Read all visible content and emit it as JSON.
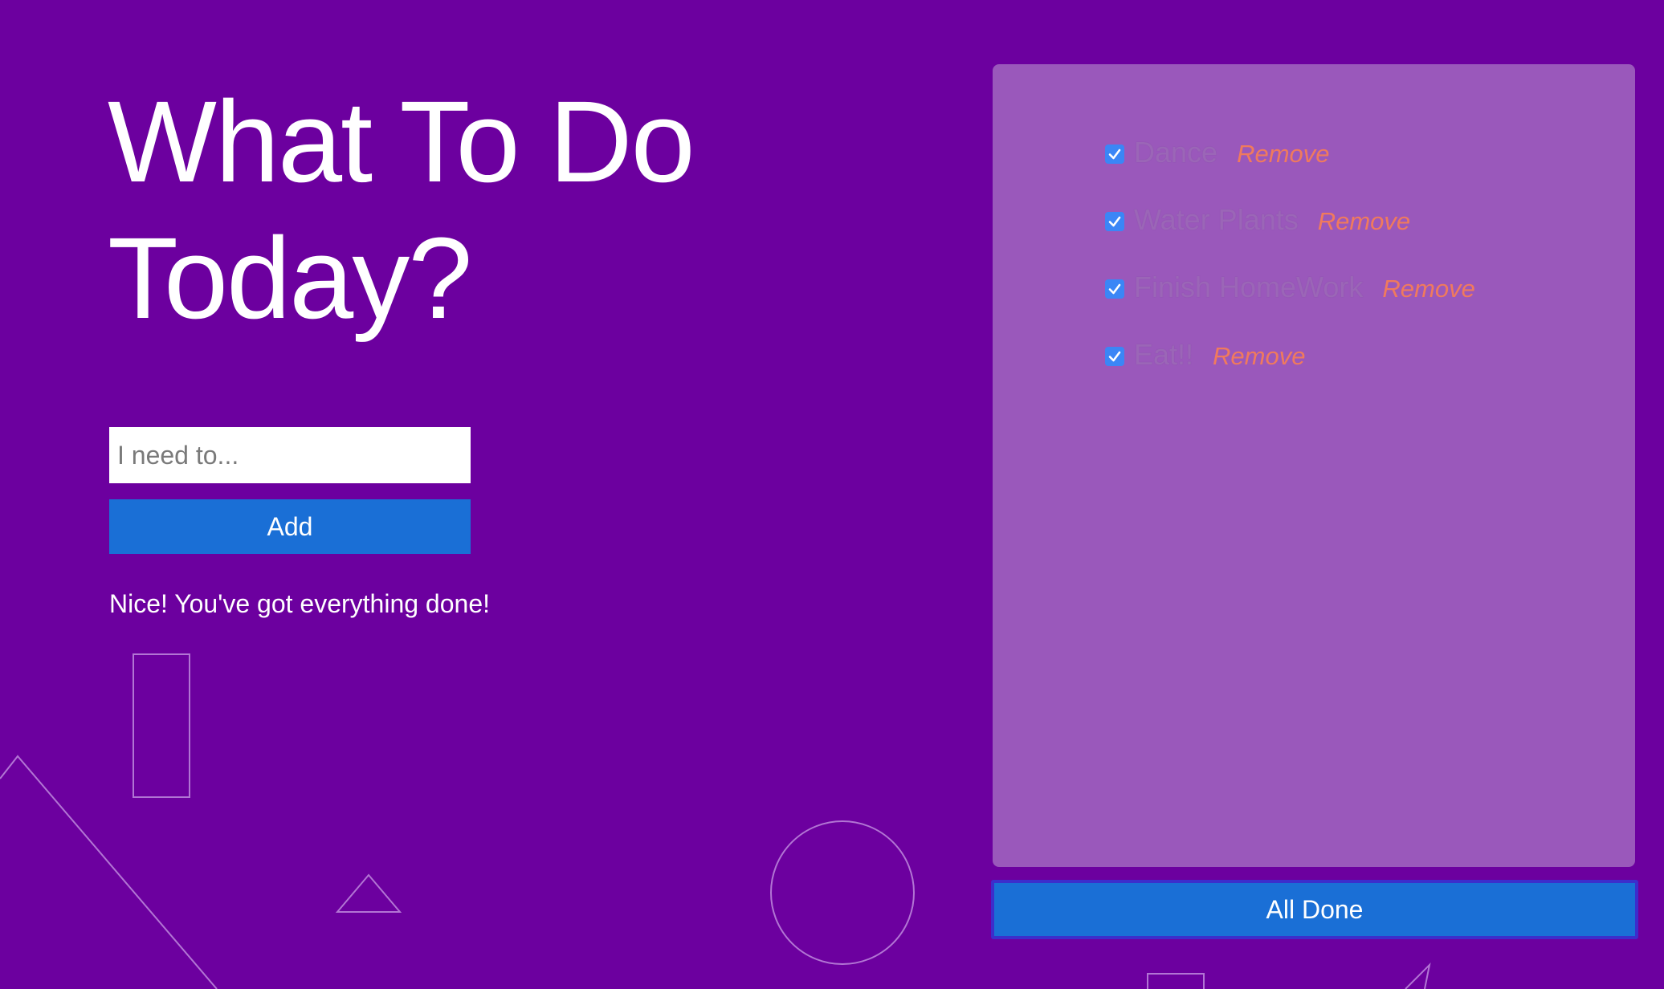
{
  "header": {
    "title_line1": "What To Do",
    "title_line2": "Today?"
  },
  "form": {
    "input_placeholder": "I need to...",
    "input_value": "",
    "add_label": "Add"
  },
  "status_message": "Nice! You've got everything done!",
  "todos": [
    {
      "text": "Dance",
      "done": true,
      "remove_label": "Remove"
    },
    {
      "text": "Water Plants",
      "done": true,
      "remove_label": "Remove"
    },
    {
      "text": "Finish HomeWork",
      "done": true,
      "remove_label": "Remove"
    },
    {
      "text": "Eat!!",
      "done": true,
      "remove_label": "Remove"
    }
  ],
  "all_done_label": "All Done",
  "colors": {
    "background": "#6c009f",
    "panel": "#9a58bb",
    "button": "#1a6fd6",
    "remove_link": "#f07a5d",
    "checkbox": "#3b86f6"
  },
  "icons": {
    "checkbox": "checkmark-icon"
  }
}
